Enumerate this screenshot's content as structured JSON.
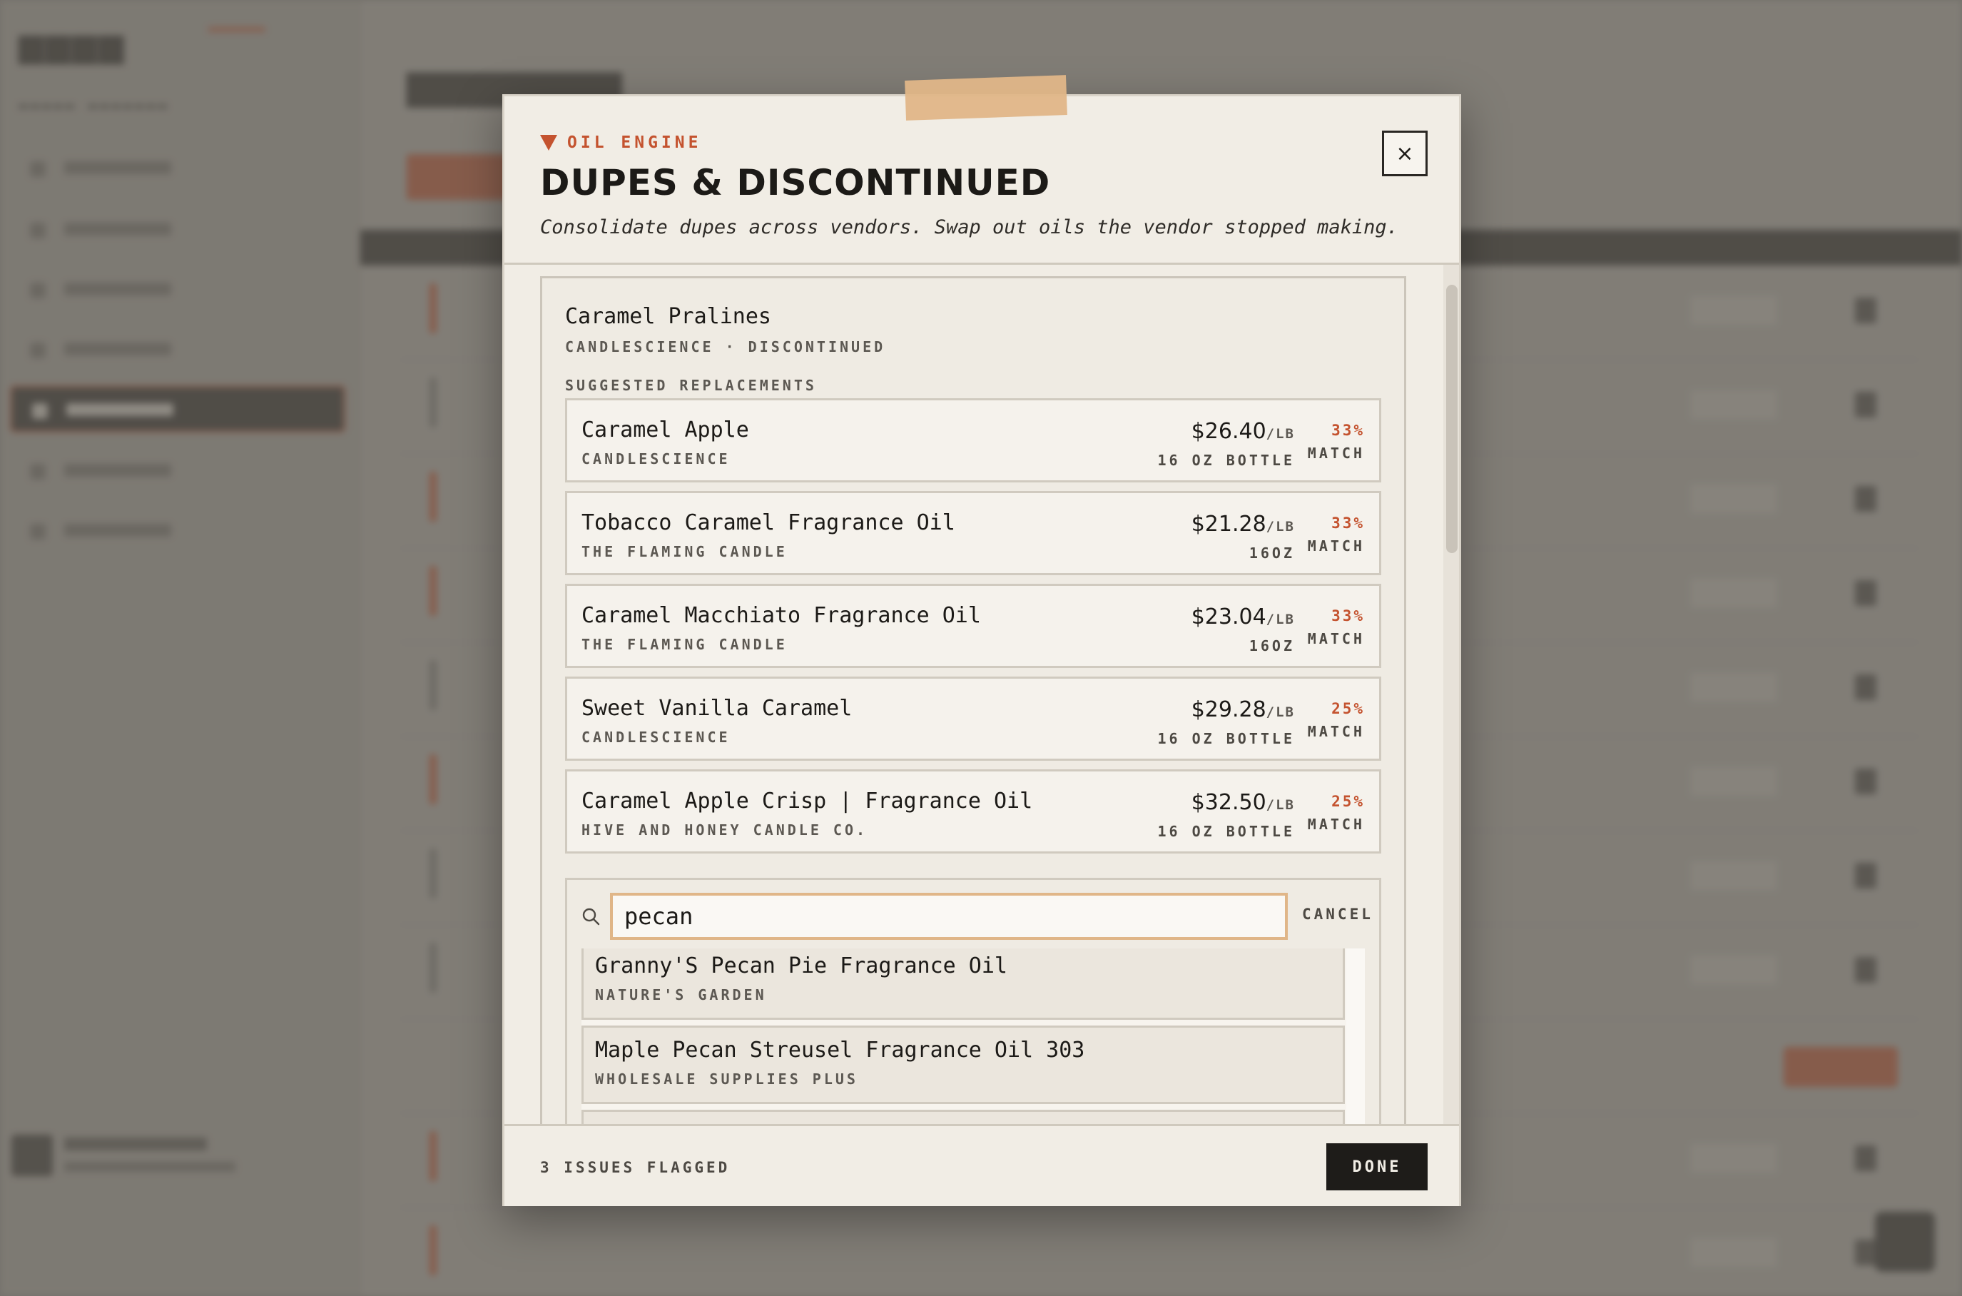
{
  "modal": {
    "eyebrow": "OIL ENGINE",
    "title": "DUPES & DISCONTINUED",
    "subtitle": "Consolidate dupes across vendors. Swap out oils the vendor stopped making.",
    "close_label": "×"
  },
  "discontinued": {
    "name": "Caramel Pralines",
    "meta": "CANDLESCIENCE · DISCONTINUED",
    "section_label": "SUGGESTED REPLACEMENTS"
  },
  "replacements": [
    {
      "name": "Caramel Apple",
      "vendor": "CANDLESCIENCE",
      "price": "$26.40",
      "unit": "/LB",
      "size": "16 OZ BOTTLE",
      "match": "33%",
      "match_label": "MATCH"
    },
    {
      "name": "Tobacco Caramel Fragrance Oil",
      "vendor": "THE FLAMING CANDLE",
      "price": "$21.28",
      "unit": "/LB",
      "size": "16OZ",
      "match": "33%",
      "match_label": "MATCH"
    },
    {
      "name": "Caramel Macchiato Fragrance Oil",
      "vendor": "THE FLAMING CANDLE",
      "price": "$23.04",
      "unit": "/LB",
      "size": "16OZ",
      "match": "33%",
      "match_label": "MATCH"
    },
    {
      "name": "Sweet Vanilla Caramel",
      "vendor": "CANDLESCIENCE",
      "price": "$29.28",
      "unit": "/LB",
      "size": "16 OZ BOTTLE",
      "match": "25%",
      "match_label": "MATCH"
    },
    {
      "name": "Caramel Apple Crisp | Fragrance Oil",
      "vendor": "HIVE AND HONEY CANDLE CO.",
      "price": "$32.50",
      "unit": "/LB",
      "size": "16 OZ BOTTLE",
      "match": "25%",
      "match_label": "MATCH"
    }
  ],
  "search": {
    "value": "pecan",
    "cancel_label": "CANCEL"
  },
  "results": [
    {
      "name": "Granny'S Pecan Pie Fragrance Oil",
      "vendor": "NATURE'S GARDEN"
    },
    {
      "name": "Maple Pecan Streusel Fragrance Oil 303",
      "vendor": "WHOLESALE SUPPLIES PLUS"
    }
  ],
  "footer": {
    "issues": "3 ISSUES FLAGGED",
    "done_label": "DONE"
  },
  "colors": {
    "accent": "#c4532f",
    "tape": "#e0b688",
    "paper": "#f1ede5",
    "ink": "#1c1a17"
  }
}
